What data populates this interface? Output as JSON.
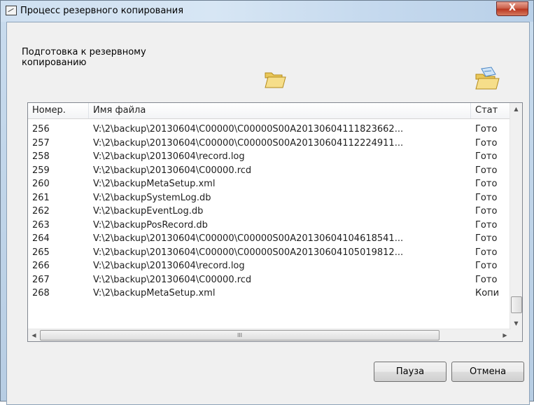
{
  "window": {
    "title": "Процесс резервного копирования",
    "close_label": "X"
  },
  "status": {
    "text": "Подготовка к резервному копированию"
  },
  "icons": {
    "folder": "open-folder-icon",
    "export": "export-folder-icon"
  },
  "table": {
    "columns": [
      "Номер.",
      "Имя файла",
      "Стат"
    ],
    "rows": [
      {
        "num": "256",
        "file": "V:\\2\\backup\\20130604\\C00000\\C00000S00A20130604111823662...",
        "status": "Гото"
      },
      {
        "num": "257",
        "file": "V:\\2\\backup\\20130604\\C00000\\C00000S00A20130604112224911...",
        "status": "Гото"
      },
      {
        "num": "258",
        "file": "V:\\2\\backup\\20130604\\record.log",
        "status": "Гото"
      },
      {
        "num": "259",
        "file": "V:\\2\\backup\\20130604\\C00000.rcd",
        "status": "Гото"
      },
      {
        "num": "260",
        "file": "V:\\2\\backupMetaSetup.xml",
        "status": "Гото"
      },
      {
        "num": "261",
        "file": "V:\\2\\backupSystemLog.db",
        "status": "Гото"
      },
      {
        "num": "262",
        "file": "V:\\2\\backupEventLog.db",
        "status": "Гото"
      },
      {
        "num": "263",
        "file": "V:\\2\\backupPosRecord.db",
        "status": "Гото"
      },
      {
        "num": "264",
        "file": "V:\\2\\backup\\20130604\\C00000\\C00000S00A20130604104618541...",
        "status": "Гото"
      },
      {
        "num": "265",
        "file": "V:\\2\\backup\\20130604\\C00000\\C00000S00A20130604105019812...",
        "status": "Гото"
      },
      {
        "num": "266",
        "file": "V:\\2\\backup\\20130604\\record.log",
        "status": "Гото"
      },
      {
        "num": "267",
        "file": "V:\\2\\backup\\20130604\\C00000.rcd",
        "status": "Гото"
      },
      {
        "num": "268",
        "file": "V:\\2\\backupMetaSetup.xml",
        "status": "Копи"
      }
    ]
  },
  "scrollbar": {
    "thumb_grip": "III"
  },
  "buttons": {
    "pause": "Пауза",
    "cancel": "Отмена"
  }
}
